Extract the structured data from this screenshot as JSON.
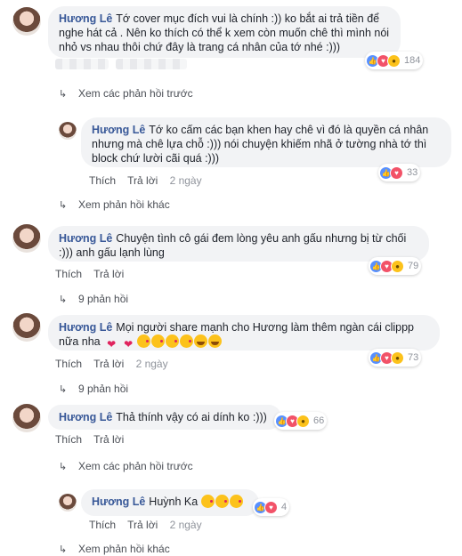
{
  "comments": [
    {
      "author": "Hương Lê",
      "text": "Tớ cover mục đích vui là chính :)) ko bắt ai trả tiền để nghe hát cả . Nên ko thích có thể k xem còn muốn chê thì mình nói nhỏ vs nhau thôi chứ đây là trang cá nhân của tớ nhé :)))",
      "reaction_count": "184"
    },
    {
      "author": "Hương Lê",
      "text": "Tớ ko cấm các bạn khen hay chê vì đó là quyền cá nhân nhưng mà chê lựa chỗ :))) nói chuyện khiếm nhã ở tường nhà tớ thì block chứ lười cãi quá :)))",
      "reaction_count": "33",
      "actions": {
        "like": "Thích",
        "reply": "Trả lời",
        "time": "2 ngày"
      }
    },
    {
      "author": "Hương Lê",
      "text": "Chuyện tình cô gái đem lòng yêu anh gấu nhưng bị từ chối :))) anh gấu lạnh lùng",
      "reaction_count": "79",
      "actions": {
        "like": "Thích",
        "reply": "Trả lời"
      }
    },
    {
      "author": "Hương Lê",
      "text": "Mọi người share mạnh cho Hương làm thêm ngàn cái clippp nữa nha",
      "reaction_count": "73",
      "actions": {
        "like": "Thích",
        "reply": "Trả lời",
        "time": "2 ngày"
      }
    },
    {
      "author": "Hương Lê",
      "text": "Thả thính vậy có ai dính ko :)))",
      "reaction_count": "66",
      "actions": {
        "like": "Thích",
        "reply": "Trả lời"
      }
    },
    {
      "author": "Hương Lê",
      "text": "Huỳnh Ka",
      "reaction_count": "4",
      "actions": {
        "like": "Thích",
        "reply": "Trả lời",
        "time": "2 ngày"
      }
    }
  ],
  "links": {
    "previous_replies": "Xem các phản hồi trước",
    "other_replies": "Xem phản hồi khác",
    "nine_replies": "9 phản hồi"
  },
  "colors": {
    "author": "#385898",
    "bubble": "#f2f3f5",
    "like": "#5890ff",
    "love": "#f25268",
    "haha": "#fcc21b"
  },
  "icons": [
    "reply-arrow-icon",
    "like-reaction-icon",
    "love-reaction-icon",
    "haha-reaction-icon",
    "kiss-emoji-icon",
    "lips-emoji-icon",
    "grin-emoji-icon"
  ]
}
